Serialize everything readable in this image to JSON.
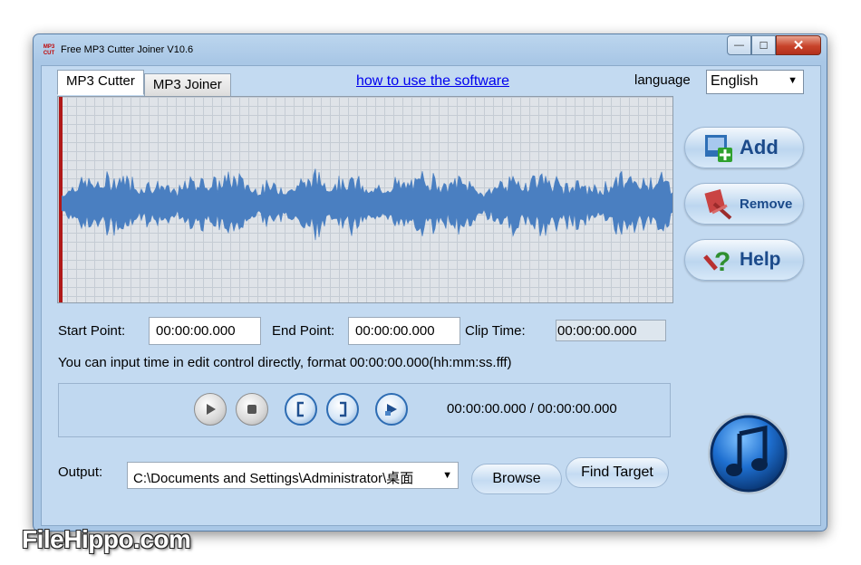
{
  "window": {
    "title": "Free MP3 Cutter Joiner V10.6",
    "app_icon_text": "MP3 CUT",
    "controls": {
      "minimize": "—",
      "maximize": "☐",
      "close": "✕"
    }
  },
  "tabs": [
    {
      "label": "MP3 Cutter",
      "active": true
    },
    {
      "label": "MP3 Joiner",
      "active": false
    }
  ],
  "header": {
    "help_link": "how to use the software",
    "language_label": "language",
    "language_value": "English"
  },
  "side_buttons": {
    "add": "Add",
    "remove": "Remove",
    "help": "Help"
  },
  "times": {
    "start_label": "Start Point:",
    "start_value": "00:00:00.000",
    "end_label": "End Point:",
    "end_value": "00:00:00.000",
    "clip_label": "Clip Time:",
    "clip_value": "00:00:00.000"
  },
  "hint": "You can input time in edit control directly, format 00:00:00.000(hh:mm:ss.fff)",
  "player": {
    "position": "00:00:00.000 / 00:00:00.000",
    "icons": [
      "play-icon",
      "stop-icon",
      "mark-start-icon",
      "mark-end-icon",
      "play-selection-icon"
    ]
  },
  "output": {
    "label": "Output:",
    "path": "C:\\Documents and Settings\\Administrator\\桌面",
    "browse": "Browse",
    "find_target": "Find Target"
  },
  "watermark": "FileHippo.com",
  "colors": {
    "waveform": "#4a7fc1",
    "cursor": "#b01818",
    "link": "#0000ee",
    "button_text": "#1b4a8a"
  }
}
